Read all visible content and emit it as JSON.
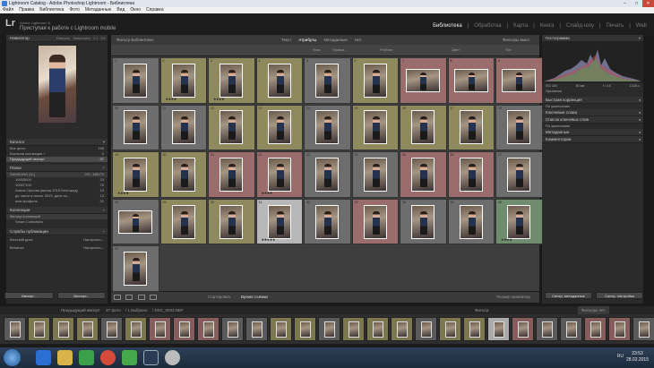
{
  "window": {
    "title": "Lightroom Catalog - Adobe Photoshop Lightroom - Библиотека",
    "min": "–",
    "max": "□",
    "close": "✕"
  },
  "menu": [
    "Файл",
    "Правка",
    "Библиотека",
    "Фото",
    "Метаданные",
    "Вид",
    "Окно",
    "Справка"
  ],
  "identity": {
    "logo": "Lr",
    "subtitle": "Adobe Lightroom 6",
    "title": "Приступая к работе с Lightroom mobile"
  },
  "modules": [
    "Библиотека",
    "Обработка",
    "Карта",
    "Книга",
    "Слайд-шоу",
    "Печать",
    "Web"
  ],
  "left": {
    "navigator": {
      "title": "Навигатор",
      "tabs": [
        "Вписать",
        "Заполнить",
        "1:1",
        "3:1"
      ]
    },
    "catalog": {
      "title": "Каталог",
      "items": [
        {
          "label": "Все фото",
          "count": "158"
        },
        {
          "label": "Быстрая коллекция +",
          "count": "0"
        },
        {
          "label": "Предыдущий импорт",
          "count": "37"
        }
      ]
    },
    "folders": {
      "title": "Папки",
      "volume": "SAMSUNG (G:)",
      "volume_size": "2/0 / 465 ГБ",
      "items": [
        {
          "label": "10003000",
          "count": "23"
        },
        {
          "label": "10007100",
          "count": "76"
        },
        {
          "label": "Алена Орлова (весна 2015 Белгород)",
          "count": "10"
        },
        {
          "label": "до части и после 2013, день по...",
          "count": "13"
        },
        {
          "label": "моя профиль",
          "count": "21"
        }
      ]
    },
    "collections": {
      "title": "Коллекции",
      "filter": "Фильтр коллекций",
      "smart": "Smart Collections"
    },
    "services": {
      "title": "Службы публикации",
      "items": [
        {
          "label": "Жесткий диск",
          "action": "Настроить..."
        },
        {
          "label": "Behance",
          "action": "Настроить..."
        }
      ]
    },
    "import_btn": "Импорт...",
    "export_btn": "Экспорт..."
  },
  "filterbar": {
    "title": "Фильтр Библиотеки:",
    "tabs": [
      "Текст",
      "Атрибуты",
      "Метаданные",
      "Нет"
    ],
    "preset": "Фильтры выкл."
  },
  "attrbar": {
    "flag": "Флаг",
    "edit": "Правка",
    "rating": "Рейтинг",
    "color": "Цвет",
    "kind": "Тип"
  },
  "grid": [
    {
      "n": "1",
      "c": "n",
      "s": ""
    },
    {
      "n": "2",
      "c": "y",
      "s": "★★★★"
    },
    {
      "n": "3",
      "c": "y",
      "s": "★★★★"
    },
    {
      "n": "4",
      "c": "y",
      "s": ""
    },
    {
      "n": "5",
      "c": "n",
      "s": ""
    },
    {
      "n": "6",
      "c": "y",
      "s": ""
    },
    {
      "n": "7",
      "c": "r",
      "s": "",
      "l": true
    },
    {
      "n": "8",
      "c": "r",
      "s": "",
      "l": true
    },
    {
      "n": "9",
      "c": "r",
      "s": "",
      "l": true
    },
    {
      "n": "10",
      "c": "n",
      "s": ""
    },
    {
      "n": "11",
      "c": "n",
      "s": ""
    },
    {
      "n": "12",
      "c": "y",
      "s": ""
    },
    {
      "n": "13",
      "c": "y",
      "s": ""
    },
    {
      "n": "14",
      "c": "n",
      "s": ""
    },
    {
      "n": "15",
      "c": "y",
      "s": ""
    },
    {
      "n": "16",
      "c": "y",
      "s": ""
    },
    {
      "n": "17",
      "c": "y",
      "s": ""
    },
    {
      "n": "18",
      "c": "n",
      "s": ""
    },
    {
      "n": "19",
      "c": "y",
      "s": "★★★★"
    },
    {
      "n": "20",
      "c": "y",
      "s": ""
    },
    {
      "n": "21",
      "c": "r",
      "s": ""
    },
    {
      "n": "22",
      "c": "r",
      "s": "★★★★"
    },
    {
      "n": "23",
      "c": "n",
      "s": ""
    },
    {
      "n": "24",
      "c": "n",
      "s": ""
    },
    {
      "n": "25",
      "c": "r",
      "s": ""
    },
    {
      "n": "26",
      "c": "r",
      "s": ""
    },
    {
      "n": "27",
      "c": "n",
      "s": ""
    },
    {
      "n": "28",
      "c": "n",
      "s": "",
      "l": true
    },
    {
      "n": "29",
      "c": "y",
      "s": ""
    },
    {
      "n": "30",
      "c": "y",
      "s": ""
    },
    {
      "n": "31",
      "c": "sel",
      "s": "★★★★★"
    },
    {
      "n": "32",
      "c": "n",
      "s": ""
    },
    {
      "n": "33",
      "c": "r",
      "s": ""
    },
    {
      "n": "34",
      "c": "n",
      "s": ""
    },
    {
      "n": "35",
      "c": "n",
      "s": ""
    },
    {
      "n": "36",
      "c": "g",
      "s": "★★★★"
    },
    {
      "n": "37",
      "c": "n",
      "s": ""
    }
  ],
  "toolbar": {
    "sort_label": "Сортировка:",
    "sort_value": "Время съёмки",
    "thumbs": "Размер миниатюр"
  },
  "right": {
    "histogram": {
      "title": "Гистограмма",
      "iso": "ISO 400",
      "focal": "50 мм",
      "aperture": "f / 4,5",
      "shutter": "1/125 с",
      "original": "Оригинал"
    },
    "quick": {
      "title": "Быстрая коррекция",
      "preset": "По умолчанию"
    },
    "keywords": {
      "title": "Ключевые слова"
    },
    "keyword_list": {
      "title": "Список ключевых слов"
    },
    "metadata": {
      "title": "Метаданные",
      "preset": "По умолчанию"
    },
    "comments": {
      "title": "Комментарии"
    },
    "sync_meta": "Синхр. метаданные",
    "sync_settings": "Синхр. настройки"
  },
  "filmstrip": {
    "source": "Предыдущий импорт",
    "count": "37 фото",
    "selection": "/ 1 выбрано",
    "file": "/ DSC_0033.NEF",
    "filter_label": "Фильтр:",
    "filter_value": "Фильтры нет"
  },
  "taskbar": {
    "lang": "RU",
    "time": "23:53",
    "date": "28.02.2015"
  }
}
